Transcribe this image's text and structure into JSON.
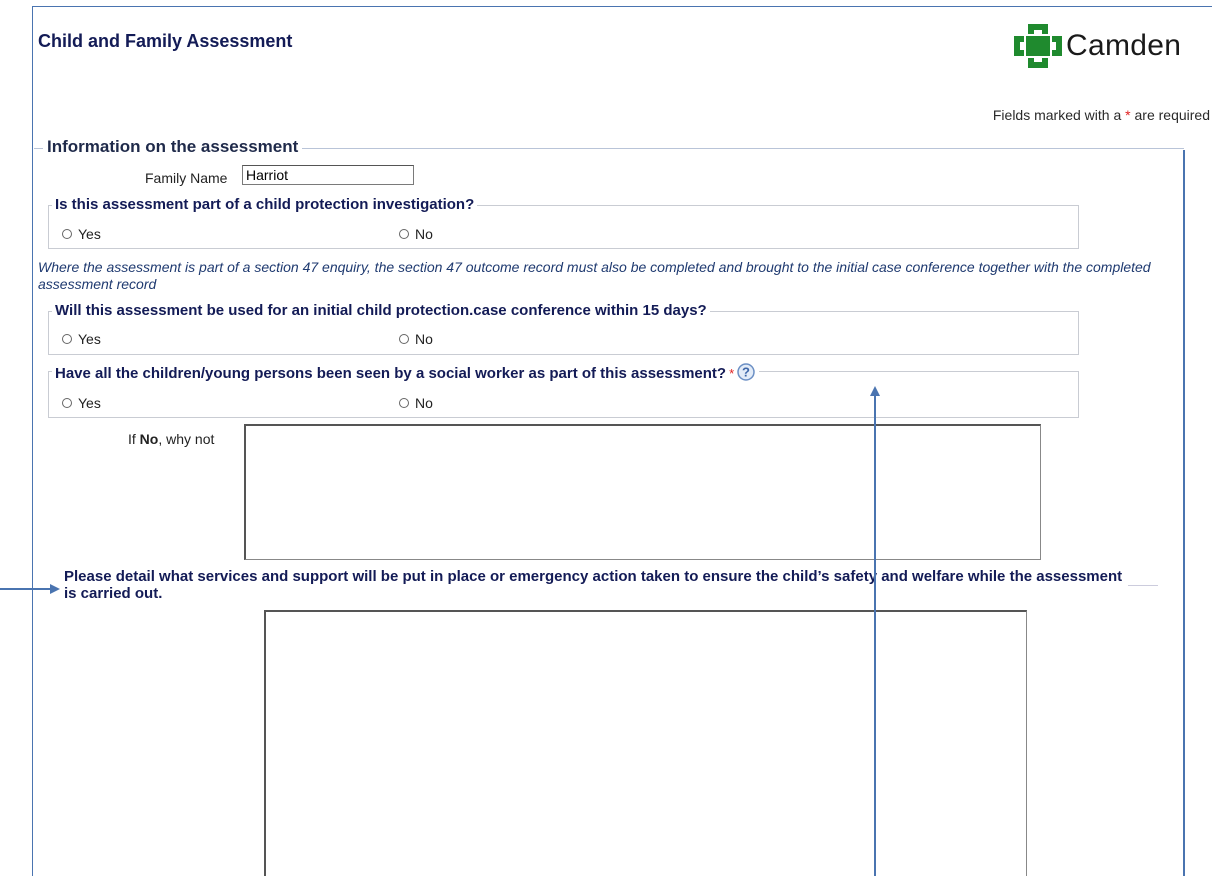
{
  "header": {
    "title": "Child and Family Assessment",
    "logo_text": "Camden"
  },
  "required_note": {
    "prefix": "Fields marked with a ",
    "star": "*",
    "suffix": " are required"
  },
  "section": {
    "title": "Information on the assessment"
  },
  "family_name": {
    "label": "Family Name",
    "value": "Harriot"
  },
  "q1": {
    "legend": "Is this assessment part of a child protection investigation?",
    "yes": "Yes",
    "no": "No"
  },
  "note": "Where the assessment is part of a section 47 enquiry, the section 47 outcome record must also be completed and brought to the initial case conference together with the completed assessment record",
  "q2": {
    "legend": "Will this assessment be used for an initial child protection.case conference within 15 days?",
    "yes": "Yes",
    "no": "No"
  },
  "q3": {
    "legend": "Have all the children/young persons been seen by a social worker as part of this assessment?",
    "required_star": "*",
    "yes": "Yes",
    "no": "No"
  },
  "why_not": {
    "prefix": "If ",
    "bold": "No",
    "suffix": ", why not"
  },
  "services": {
    "label": "Please detail what services and support will be put in place or emergency action taken to ensure the child’s safety and welfare while the assessment is carried out."
  },
  "colors": {
    "title": "#131b56",
    "annotation_arrow": "#4a74b0",
    "logo_green": "#1f8a2e",
    "required": "#e02020"
  },
  "icons": {
    "help": "question-mark-help-icon",
    "logo": "camden-logo-icon"
  }
}
